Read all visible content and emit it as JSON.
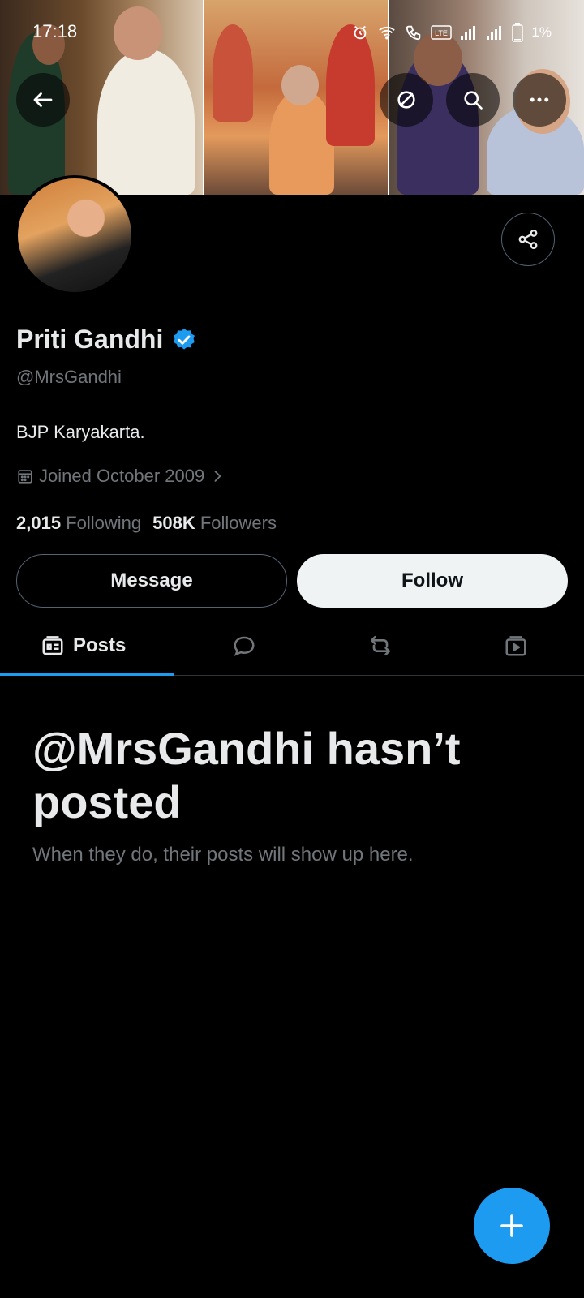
{
  "status_bar": {
    "time": "17:18",
    "battery": "1%",
    "icons": [
      "alarm-icon",
      "wifi-icon",
      "call-icon",
      "volte-icon",
      "signal-icon",
      "signal-icon",
      "battery-icon"
    ]
  },
  "header": {
    "back_icon": "arrow-left-icon",
    "toolbar_icons": [
      "sync-icon",
      "search-icon",
      "more-icon"
    ]
  },
  "profile": {
    "name": "Priti Gandhi",
    "verified": true,
    "handle": "@MrsGandhi",
    "bio": "BJP Karyakarta.",
    "joined": "Joined October 2009",
    "following_count": "2,015",
    "following_label": "Following",
    "followers_count": "508K",
    "followers_label": "Followers"
  },
  "actions": {
    "message_label": "Message",
    "follow_label": "Follow",
    "share_icon": "share-icon"
  },
  "tabs": [
    {
      "label": "Posts",
      "icon": "posts-icon",
      "active": true
    },
    {
      "label": "",
      "icon": "reply-icon"
    },
    {
      "label": "",
      "icon": "repost-icon"
    },
    {
      "label": "",
      "icon": "media-icon"
    }
  ],
  "empty_state": {
    "title": "@MrsGandhi hasn’t posted",
    "subtitle": "When they do, their posts will show up here."
  },
  "colors": {
    "background": "#000000",
    "accent": "#1d9bf0",
    "text_primary": "#e7e9ea",
    "text_secondary": "#71767b",
    "follow_bg": "#eff3f4"
  }
}
